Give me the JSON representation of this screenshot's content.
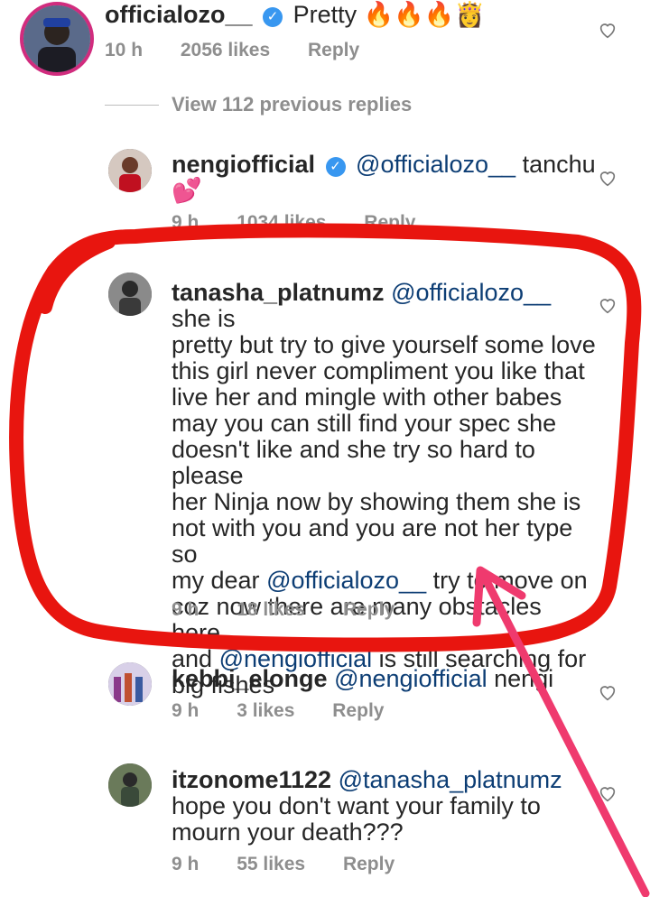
{
  "comments": [
    {
      "username": "officialozo__",
      "verified": true,
      "text": "Pretty",
      "emoji": "🔥🔥🔥👸",
      "time": "10 h",
      "likes": "2056 likes",
      "reply": "Reply"
    },
    {
      "username": "nengiofficial",
      "verified": true,
      "mention": "@officialozo__",
      "text": "tanchu",
      "emoji": "💕",
      "time": "9 h",
      "likes": "1034 likes",
      "reply": "Reply"
    },
    {
      "username": "tanasha_platnumz",
      "mention": "@officialozo__",
      "line1_rest": "she is",
      "lines": [
        "pretty but try to give yourself some love",
        "this girl never compliment you like that",
        "live her and mingle with other babes",
        "may you can still find your spec she",
        "doesn't like and she try so hard to please",
        "her Ninja now by showing them she is",
        "not with you and you are not her type so"
      ],
      "line9_pre": "my dear",
      "line9_mention": "@officialozo__",
      "line9_post": "try to move on",
      "line10": "coz now there are many obstacles here",
      "line11_pre": "and",
      "line11_mention": "@nengiofficial",
      "line11_post": "is still searching for",
      "line12": "big fishes",
      "time": "9 h",
      "likes": "18 likes",
      "reply": "Reply"
    },
    {
      "username": "kebbi_elonge",
      "mention": "@nengiofficial",
      "text": "nengi",
      "time": "9 h",
      "likes": "3 likes",
      "reply": "Reply"
    },
    {
      "username": "itzonome1122",
      "mention": "@tanasha_platnumz",
      "line2": "hope you don't want your family to",
      "line3": "mourn your death???",
      "time": "9 h",
      "likes": "55 likes",
      "reply": "Reply"
    }
  ],
  "view_previous": "View 112 previous replies",
  "colors": {
    "annotation_red": "#e8150f",
    "arrow_pink": "#ef3a6e",
    "mention_blue": "#0c3d74"
  }
}
